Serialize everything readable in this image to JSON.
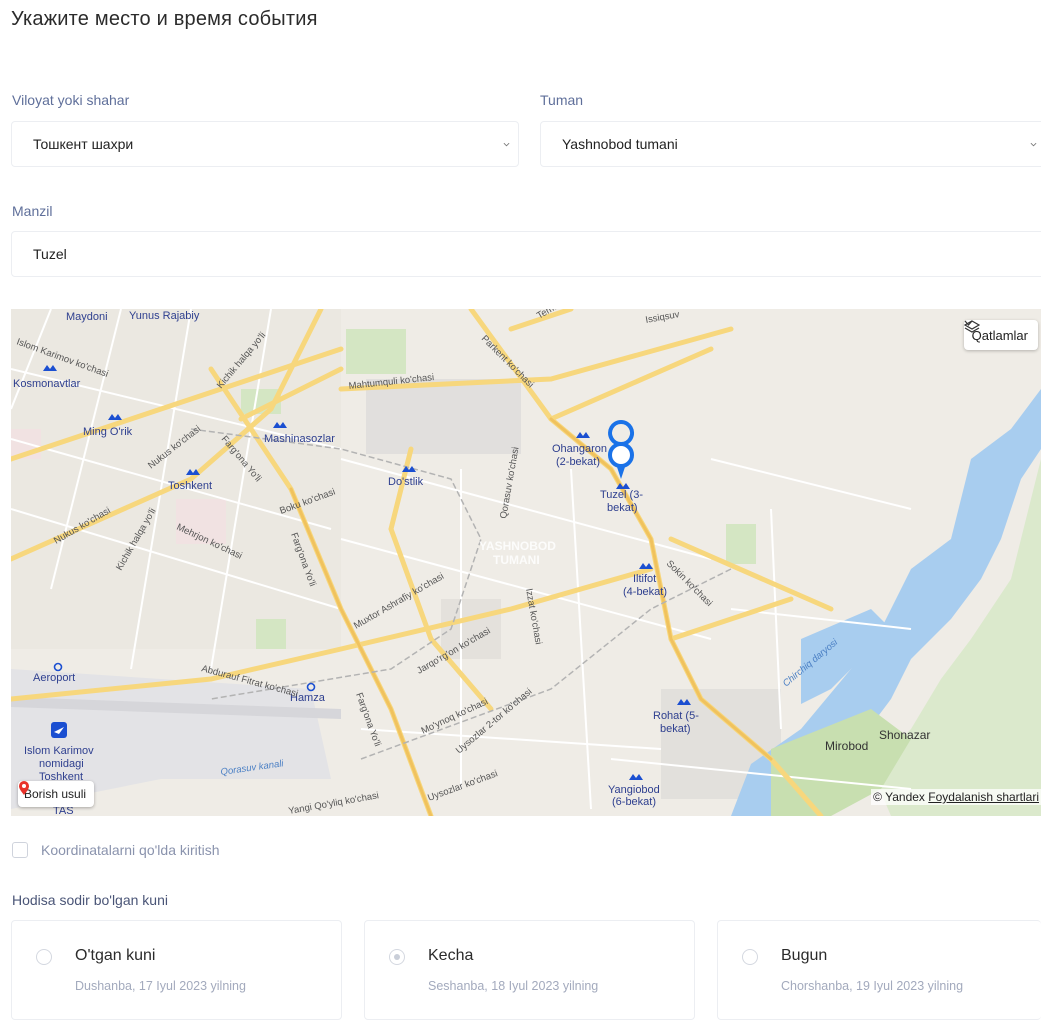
{
  "page_title": "Укажите место и время события",
  "region": {
    "label": "Viloyat yoki shahar",
    "value": "Тошкент шахри"
  },
  "district": {
    "label": "Tuman",
    "value": "Yashnobod tumani"
  },
  "address": {
    "label": "Manzil",
    "value": "Tuzel"
  },
  "map": {
    "layers_label": "Qatlamlar",
    "route_label": "Borish usuli",
    "copyright": "© Yandex",
    "terms": "Foydalanish shartlari",
    "labels": {
      "maydoni": "Maydoni",
      "yunus": "Yunus Rajabiy",
      "islom_karimov_st": "Islom Karimov ko'chasi",
      "kosmonavtlar": "Kosmonavtlar",
      "ming_orik": "Ming O'rik",
      "mashinasozlar": "Mashinasozlar",
      "toshkent": "Toshkent",
      "dostlik": "Do'stlik",
      "ohangaron": "Ohangaron",
      "ohangaron2": "(2-bekat)",
      "tuzel": "Tuzel (3-",
      "tuzel2": "bekat)",
      "yashnobod": "YASHNOBOD",
      "tumani": "TUMANI",
      "iltifot": "Iltifot",
      "iltifot2": "(4-bekat)",
      "aeroport": "Aeroport",
      "hamza": "Hamza",
      "rohat": "Rohat (5-",
      "rohat2": "bekat)",
      "yangiobod": "Yangiobod",
      "yangiobod2": "(6-bekat)",
      "mirobod": "Mirobod",
      "shonazar": "Shonazar",
      "airport1": "Islom Karimov",
      "airport2": "nomidagi",
      "airport3": "Toshkent",
      "tas": "TAS",
      "mahtumquli": "Mahtumquli ko'chasi",
      "parkent": "Parkent ko'chasi",
      "temur": "Temu",
      "qorasuv_st": "Qorasuv ko'chasi",
      "nukus": "Nukus ko'chasi",
      "nukus2": "Nukus ko'chasi",
      "kichik": "Kichik halqa yo'li",
      "kichik2": "Kichik halqa yo'li",
      "fargona": "Farg'ona Yo'li",
      "fargona2": "Farg'ona Yo'li",
      "fargona3": "Farg'ona Yo'li",
      "boku": "Boku ko'chasi",
      "mehrjon": "Mehrjon ko'chasi",
      "muxtor": "Muxtor Ashrafiy ko'chasi",
      "jarqorgon": "Jarqo'rg'on ko'chasi",
      "izzat": "Izzat ko'chasi",
      "sokin": "Sokin ko'chasi",
      "abdurauf": "Abdurauf Fitrat ko'chasi",
      "moynoq": "Mo'ynoq ko'chasi",
      "uysozlar": "Uysozlar 2-tor ko'chasi",
      "uysozlar2": "Uysozlar ko'chasi",
      "yangi": "Yangi Qo'yliq ko'chasi",
      "qorasuv_canal": "Qorasuv kanali",
      "chirchiq": "Chirchiq daryosi",
      "issiqsuv": "Issiqsuv"
    }
  },
  "manual_coords": {
    "label": "Koordinatalarni qo'lda kiritish"
  },
  "date_section": {
    "label": "Hodisa sodir bo'lgan kuni",
    "options": [
      {
        "name": "O'tgan kuni",
        "date": "Dushanba, 17 Iyul 2023 yilning"
      },
      {
        "name": "Kecha",
        "date": "Seshanba, 18 Iyul 2023 yilning"
      },
      {
        "name": "Bugun",
        "date": "Chorshanba, 19 Iyul 2023 yilning"
      }
    ]
  }
}
